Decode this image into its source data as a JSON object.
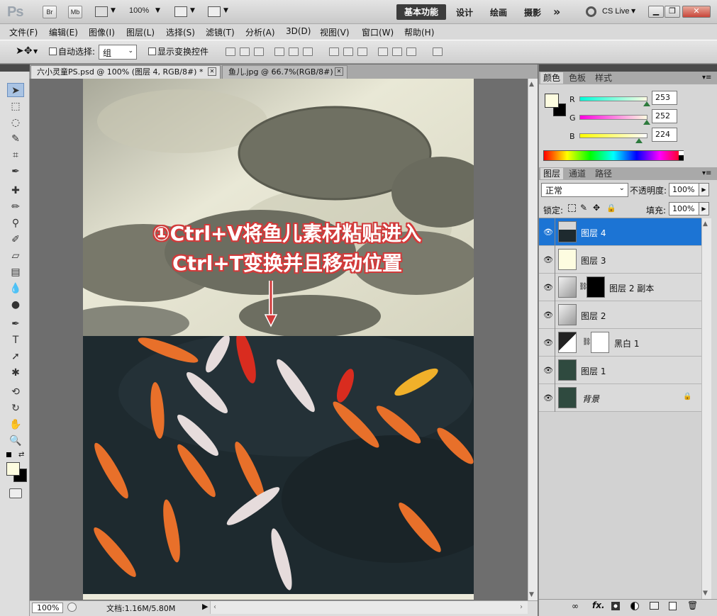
{
  "app": {
    "logo": "Ps",
    "bridge_btn": "Br",
    "minibridge_btn": "Mb",
    "zoom": "100%",
    "workspaces": [
      "基本功能",
      "设计",
      "绘画",
      "摄影"
    ],
    "more": "»",
    "cs_live": "CS Live"
  },
  "menu": [
    "文件(F)",
    "编辑(E)",
    "图像(I)",
    "图层(L)",
    "选择(S)",
    "滤镜(T)",
    "分析(A)",
    "3D(D)",
    "视图(V)",
    "窗口(W)",
    "帮助(H)"
  ],
  "options": {
    "auto_select_label": "自动选择:",
    "auto_select_value": "组",
    "show_transform_label": "显示变换控件"
  },
  "tabs": [
    {
      "label": "六小灵童PS.psd @ 100% (图层 4, RGB/8#) *",
      "close": "✕"
    },
    {
      "label": "鱼儿.jpg @ 66.7%(RGB/8#)",
      "close": "✕"
    }
  ],
  "annotation": {
    "line1": "①Ctrl+V将鱼儿素材粘贴进入",
    "line2": "Ctrl+T变换并且移动位置"
  },
  "status": {
    "zoom": "100%",
    "doc": "文档:1.16M/5.80M"
  },
  "color_panel": {
    "tabs": [
      "颜色",
      "色板",
      "样式"
    ],
    "r_label": "R",
    "g_label": "G",
    "b_label": "B",
    "r": "253",
    "g": "252",
    "b": "224",
    "r_level": 0.992,
    "g_level": 0.988,
    "b_level": 0.878
  },
  "layers_panel": {
    "tabs": [
      "图层",
      "通道",
      "路径"
    ],
    "blend_mode": "正常",
    "opacity_label": "不透明度:",
    "opacity": "100%",
    "lock_label": "锁定:",
    "fill_label": "填充:",
    "fill": "100%",
    "layers": [
      {
        "name": "图层 4",
        "selected": true
      },
      {
        "name": "图层 3",
        "selected": false
      },
      {
        "name": "图层 2 副本",
        "selected": false
      },
      {
        "name": "图层 2",
        "selected": false
      },
      {
        "name": "黑白 1",
        "selected": false
      },
      {
        "name": "图层 1",
        "selected": false
      },
      {
        "name": "背景",
        "selected": false
      }
    ],
    "footer_icons": [
      "link-icon",
      "fx-icon",
      "mask-icon",
      "adjustment-icon",
      "group-icon",
      "new-layer-icon",
      "trash-icon"
    ]
  },
  "colors": {
    "selected_layer": "#1c74d4",
    "foreground_swatch": "#fdfce0",
    "annotation_outline": "#d23a3a"
  }
}
